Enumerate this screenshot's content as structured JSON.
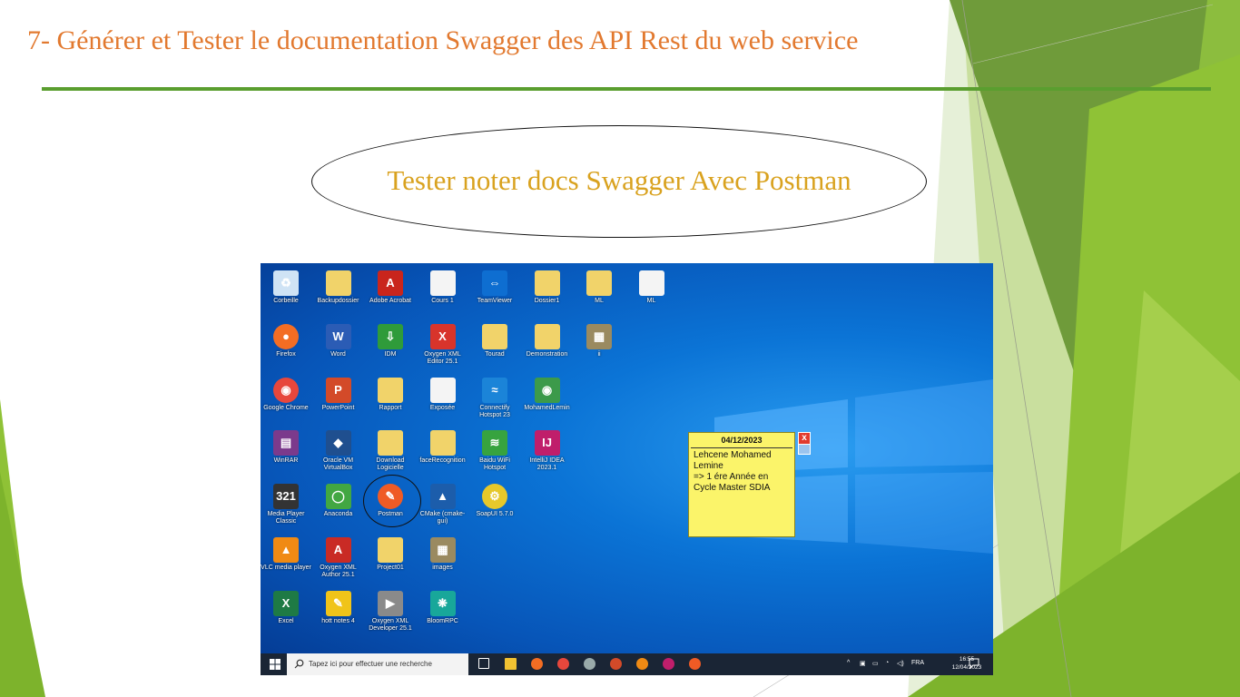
{
  "slide": {
    "title": "7- Générer et Tester le documentation Swagger des API Rest du  web service",
    "ellipse_text": "Tester noter docs Swagger Avec Postman"
  },
  "desktop": {
    "icons": [
      {
        "label": "Corbeille",
        "icon": "recycle-bin-icon"
      },
      {
        "label": "Backupdossier",
        "icon": "folder-icon"
      },
      {
        "label": "Adobe Acrobat",
        "icon": "adobe-acrobat-icon"
      },
      {
        "label": "Cours 1",
        "icon": "document-icon"
      },
      {
        "label": "TeamViewer",
        "icon": "teamviewer-icon"
      },
      {
        "label": "Dossier1",
        "icon": "folder-icon"
      },
      {
        "label": "ML",
        "icon": "folder-icon"
      },
      {
        "label": "ML",
        "icon": "document-icon"
      },
      {
        "label": "Firefox",
        "icon": "firefox-icon"
      },
      {
        "label": "Word",
        "icon": "word-icon"
      },
      {
        "label": "IDM",
        "icon": "idm-icon"
      },
      {
        "label": "Oxygen XML Editor 25.1",
        "icon": "oxygen-xml-icon"
      },
      {
        "label": "Tourad",
        "icon": "folder-icon"
      },
      {
        "label": "Demonstration",
        "icon": "folder-icon"
      },
      {
        "label": "ii",
        "icon": "image-file-icon"
      },
      {
        "label": "Google Chrome",
        "icon": "chrome-icon"
      },
      {
        "label": "PowerPoint",
        "icon": "powerpoint-icon"
      },
      {
        "label": "Rapport",
        "icon": "folder-icon"
      },
      {
        "label": "Exposée",
        "icon": "document-icon"
      },
      {
        "label": "Connectify Hotspot 23",
        "icon": "connectify-icon"
      },
      {
        "label": "MohamedLemin",
        "icon": "chrome-profile-icon"
      },
      {
        "label": "WinRAR",
        "icon": "winrar-icon"
      },
      {
        "label": "Oracle VM VirtualBox",
        "icon": "virtualbox-icon"
      },
      {
        "label": "Download Logicielle",
        "icon": "folder-icon"
      },
      {
        "label": "faceRecognition",
        "icon": "folder-icon"
      },
      {
        "label": "Baidu WiFi Hotspot",
        "icon": "wifi-hotspot-icon"
      },
      {
        "label": "IntelliJ IDEA 2023.1",
        "icon": "intellij-icon"
      },
      {
        "label": "Media Player Classic",
        "icon": "media-player-icon"
      },
      {
        "label": "Anaconda",
        "icon": "anaconda-icon"
      },
      {
        "label": "Postman",
        "icon": "postman-icon"
      },
      {
        "label": "CMake (cmake-gui)",
        "icon": "cmake-icon"
      },
      {
        "label": "SoapUI 5.7.0",
        "icon": "soapui-icon"
      },
      {
        "label": "VLC media player",
        "icon": "vlc-icon"
      },
      {
        "label": "Oxygen XML Author 25.1",
        "icon": "oxygen-author-icon"
      },
      {
        "label": "Project01",
        "icon": "folder-icon"
      },
      {
        "label": "images",
        "icon": "image-file-icon"
      },
      {
        "label": "Excel",
        "icon": "excel-icon"
      },
      {
        "label": "hott notes 4",
        "icon": "hott-notes-icon"
      },
      {
        "label": "Oxygen XML Developer 25.1",
        "icon": "oxygen-developer-icon"
      },
      {
        "label": "BloomRPC",
        "icon": "bloomrpc-icon"
      }
    ],
    "sticky_note": {
      "date": "04/12/2023",
      "text": "Lehcene Mohamed Lemine\n=>  1 ére Année en Cycle Master SDIA",
      "close_label": "x"
    }
  },
  "taskbar": {
    "search_placeholder": "Tapez ici pour effectuer une recherche",
    "language": "FRA",
    "time": "16:55",
    "date": "12/04/2023",
    "pinned": [
      "task-view-icon",
      "file-explorer-icon",
      "firefox-icon",
      "chrome-icon",
      "settings-icon",
      "powerpoint-icon",
      "vlc-icon",
      "intellij-icon",
      "postman-icon"
    ]
  }
}
